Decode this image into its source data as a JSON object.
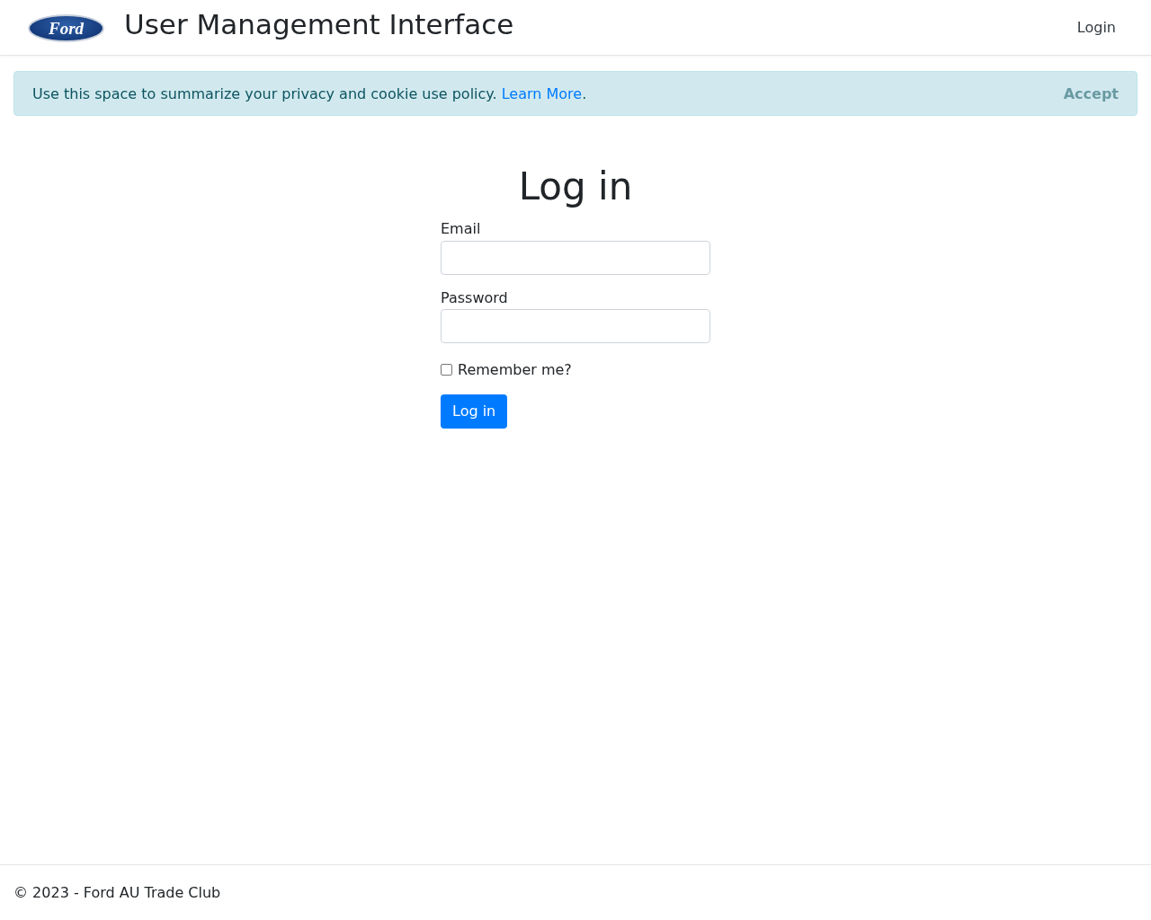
{
  "navbar": {
    "logo_text": "Ford",
    "title": "User Management Interface",
    "links": [
      {
        "label": "Login"
      }
    ]
  },
  "cookie_banner": {
    "message": "Use this space to summarize your privacy and cookie use policy.",
    "link": "Learn More",
    "after_link": ".",
    "button": "Accept"
  },
  "login_form": {
    "heading": "Log in",
    "fields": [
      {
        "label": "Email"
      },
      {
        "label": "Password"
      }
    ],
    "remember": {
      "label": "Remember me?",
      "checked": false
    },
    "submit": "Log in"
  },
  "footer": {
    "text": "© 2023 - Ford AU Trade Club"
  }
}
